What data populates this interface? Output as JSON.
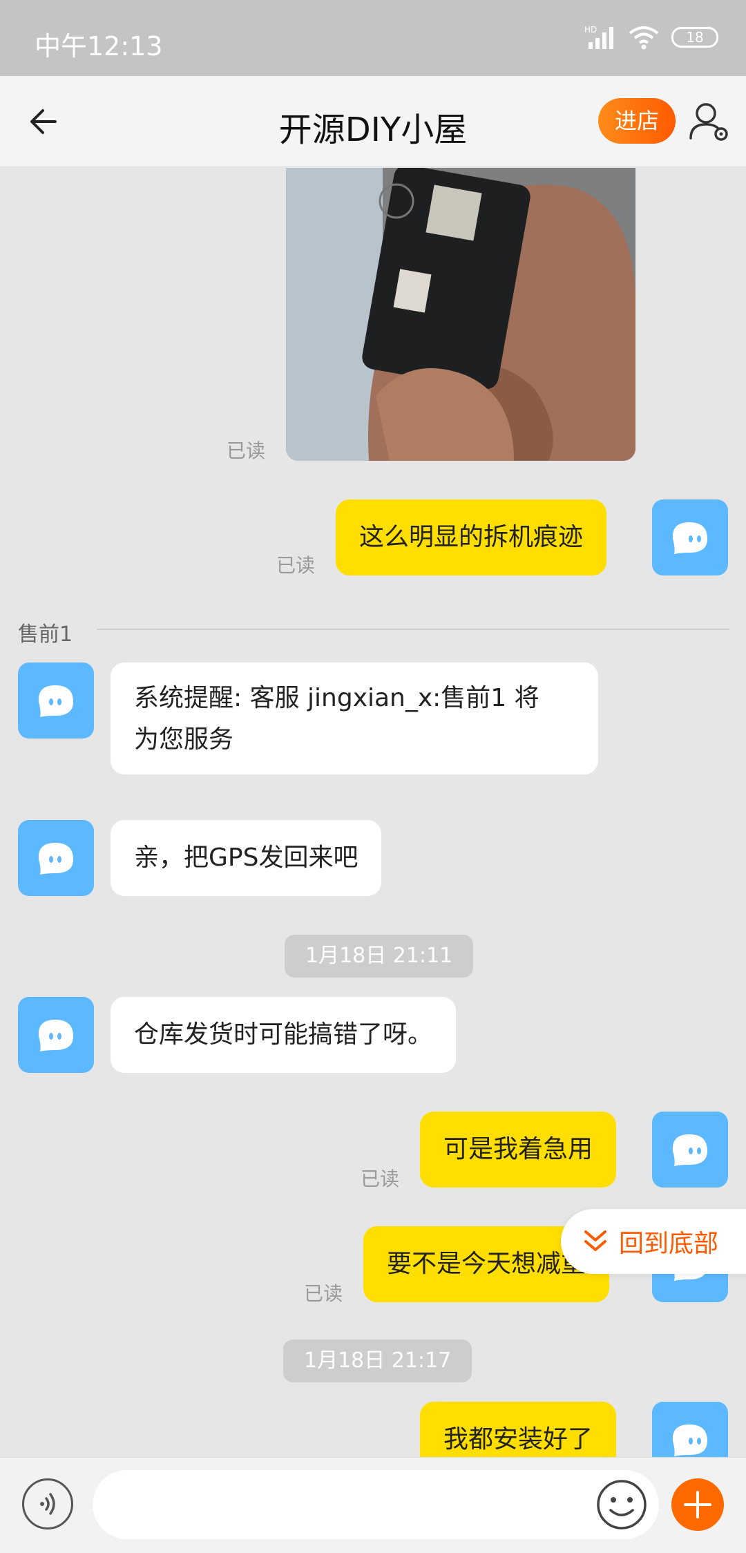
{
  "status_bar": {
    "time": "中午12:13",
    "network": "HD",
    "battery": "18"
  },
  "header": {
    "title": "开源DIY小屋",
    "store_button": "进店"
  },
  "messages": {
    "photo_read": "已读",
    "msg1": {
      "text": "这么明显的拆机痕迹",
      "read": "已读"
    },
    "divider": "售前1",
    "msg2": {
      "text_line1": "系统提醒: 客服 jingxian_x:售前1 将",
      "text_line2": "为您服务"
    },
    "msg3": {
      "text": "亲，把GPS发回来吧"
    },
    "time1": "1月18日 21:11",
    "msg4": {
      "text": "仓库发货时可能搞错了呀。"
    },
    "msg5": {
      "text": "可是我着急用",
      "read": "已读"
    },
    "msg6": {
      "text": "要不是今天想减重",
      "read": "已读"
    },
    "time2": "1月18日 21:17",
    "msg7": {
      "text": "我都安装好了"
    }
  },
  "back_to_bottom": "回到底部",
  "colors": {
    "outgoing_bubble": "#ffde00",
    "incoming_bubble": "#ffffff",
    "accent": "#ff6a00",
    "avatar": "#5cb8ff"
  }
}
